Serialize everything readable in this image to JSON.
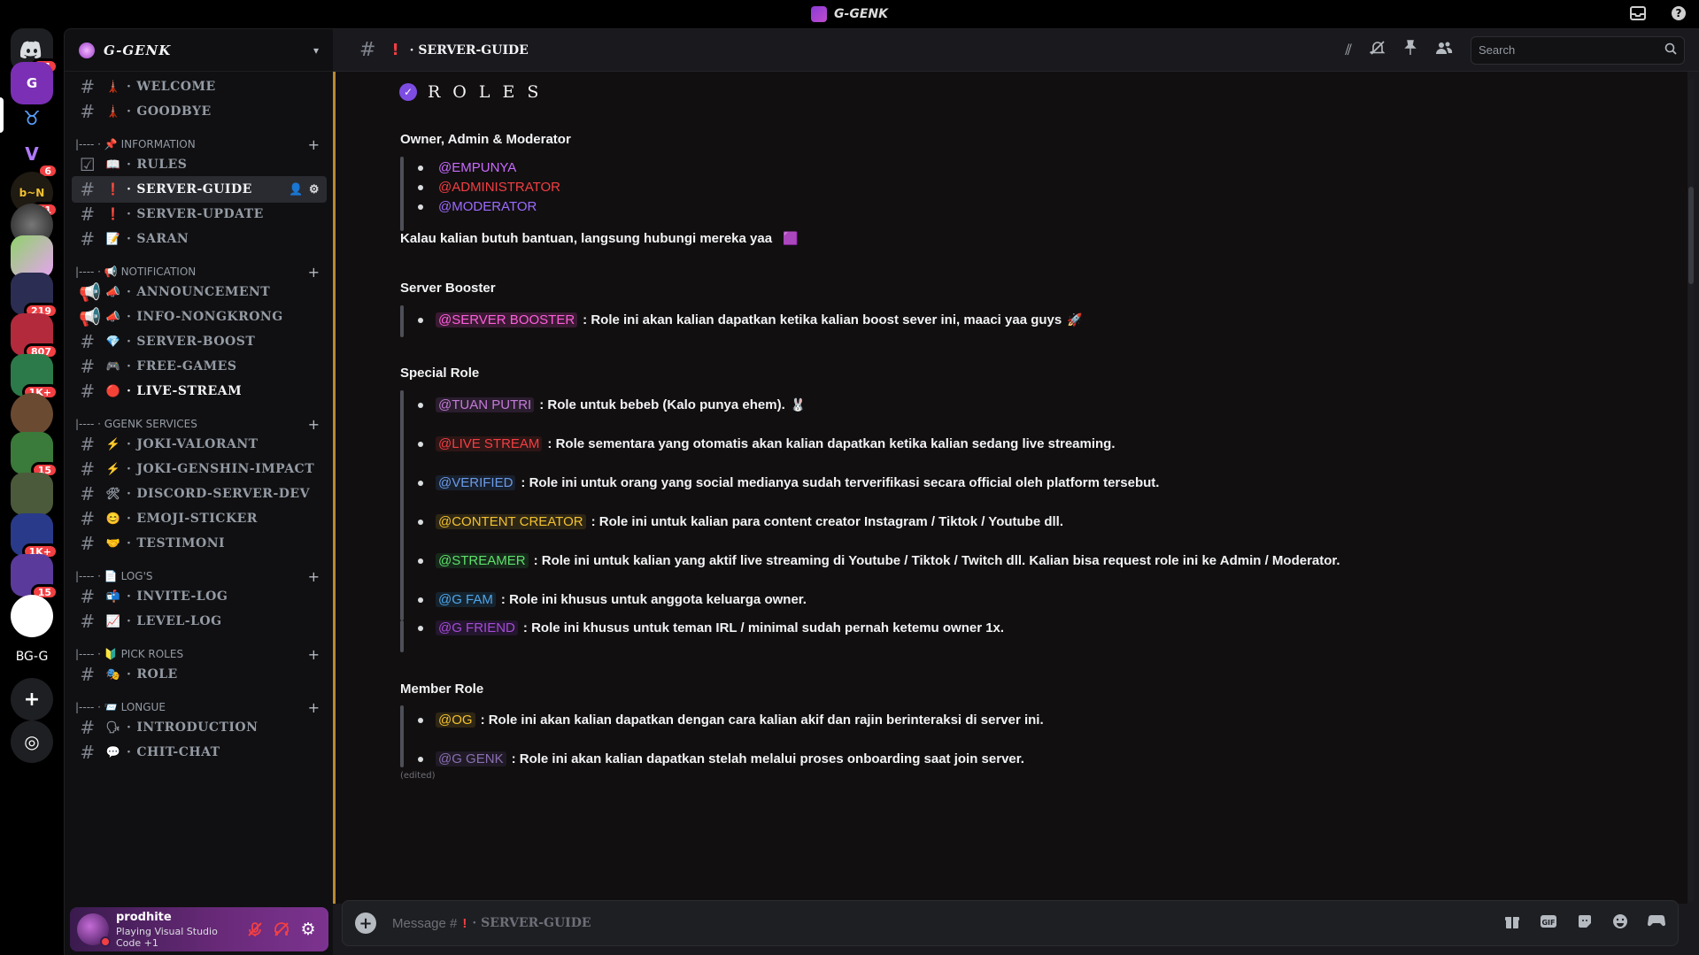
{
  "window": {
    "title": "G-GENK"
  },
  "rail": {
    "servers": [
      {
        "label": "",
        "badge": "11",
        "color": "#1e1f22",
        "icon": "discord-logo-icon"
      },
      {
        "label": "G",
        "badge": "",
        "color": "#7b2fb5",
        "icon": "g-genk-server-icon"
      },
      {
        "label": "♉",
        "badge": "",
        "color": "#000000",
        "icon": "zodiac-server-icon"
      },
      {
        "label": "V",
        "badge": "6",
        "color": "#000000",
        "icon": "v-server-icon"
      },
      {
        "label": "b~N",
        "badge": "51",
        "color": "#1f1a12",
        "icon": "bn-server-icon"
      },
      {
        "label": "",
        "badge": "",
        "color": "#3a3a3d",
        "icon": "photo-server-icon"
      },
      {
        "label": "",
        "badge": "",
        "color": "#8fd36a",
        "icon": "anime-server-icon"
      },
      {
        "label": "",
        "badge": "219",
        "color": "#4a4c7a",
        "icon": "folder-server-icon"
      },
      {
        "label": "",
        "badge": "807",
        "color": "#b32a3d",
        "icon": "folder-server-icon"
      },
      {
        "label": "",
        "badge": "1K+",
        "color": "#2c7a4a",
        "icon": "folder-server-icon"
      },
      {
        "label": "",
        "badge": "",
        "color": "#6b4a32",
        "icon": "folder-server-icon"
      },
      {
        "label": "",
        "badge": "15",
        "color": "#3a7a3a",
        "icon": "folder-server-icon"
      },
      {
        "label": "",
        "badge": "",
        "color": "#4a5a3a",
        "icon": "folder-server-icon"
      },
      {
        "label": "",
        "badge": "1K+",
        "color": "#2a3a8a",
        "icon": "folder-server-icon"
      },
      {
        "label": "",
        "badge": "15",
        "color": "#5a3a9a",
        "icon": "folder-server-icon"
      },
      {
        "label": "",
        "badge": "",
        "color": "#ffffff",
        "icon": "circle-logo-server-icon"
      },
      {
        "label": "BG-G",
        "badge": "",
        "color": "#000000",
        "icon": "text-server-icon"
      },
      {
        "label": "+",
        "badge": "",
        "color": "#1e1f22",
        "icon": "add-server-icon"
      },
      {
        "label": "◎",
        "badge": "",
        "color": "#1e1f22",
        "icon": "discover-icon"
      }
    ]
  },
  "sidebar": {
    "server_name": "G-GENK",
    "categories": [
      {
        "label": "|---- · 📌 INFORMATION",
        "key": "information"
      },
      {
        "label": "|---- · 📢 NOTIFICATION",
        "key": "notification"
      },
      {
        "label": "|---- · GGENK SERVICES",
        "key": "services"
      },
      {
        "label": "|---- · 📄 LOG'S",
        "key": "logs"
      },
      {
        "label": "|---- · 🔰 PICK ROLES",
        "key": "pickroles"
      },
      {
        "label": "|---- · 📨 LONGUE",
        "key": "longue"
      }
    ],
    "channels": [
      {
        "emoji": "🗼",
        "name": "WELCOME"
      },
      {
        "emoji": "🗼",
        "name": "GOODBYE"
      },
      {
        "emoji": "📖",
        "name": "RULES"
      },
      {
        "emoji": "❗",
        "name": "SERVER-GUIDE"
      },
      {
        "emoji": "❗",
        "name": "SERVER-UPDATE"
      },
      {
        "emoji": "📝",
        "name": "SARAN"
      },
      {
        "emoji": "📣",
        "name": "ANNOUNCEMENT"
      },
      {
        "emoji": "📣",
        "name": "INFO-NONGKRONG"
      },
      {
        "emoji": "💎",
        "name": "SERVER-BOOST"
      },
      {
        "emoji": "🎮",
        "name": "FREE-GAMES"
      },
      {
        "emoji": "🔴",
        "name": "LIVE-STREAM"
      },
      {
        "emoji": "⚡",
        "name": "JOKI-VALORANT"
      },
      {
        "emoji": "⚡",
        "name": "JOKI-GENSHIN-IMPACT"
      },
      {
        "emoji": "🛠",
        "name": "DISCORD-SERVER-DEV"
      },
      {
        "emoji": "😊",
        "name": "EMOJI-STICKER"
      },
      {
        "emoji": "🤝",
        "name": "TESTIMONI"
      },
      {
        "emoji": "📬",
        "name": "INVITE-LOG"
      },
      {
        "emoji": "📈",
        "name": "LEVEL-LOG"
      },
      {
        "emoji": "🎭",
        "name": "ROLE"
      },
      {
        "emoji": "🗣",
        "name": "INTRODUCTION"
      },
      {
        "emoji": "💬",
        "name": "CHIT-CHAT"
      }
    ],
    "user": {
      "name": "prodhite",
      "status": "Playing Visual Studio Code +1"
    }
  },
  "header": {
    "channel_name": "SERVER-GUIDE",
    "search_placeholder": "Search"
  },
  "content": {
    "title": "ROLES",
    "sec1_title": "Owner, Admin & Moderator",
    "sec1_mentions": [
      {
        "text": "@EMPUNYA",
        "color": "#c86bff"
      },
      {
        "text": "@ADMINISTRATOR",
        "color": "#f23f43"
      },
      {
        "text": "@MODERATOR",
        "color": "#9b6bff"
      }
    ],
    "sec1_note": "Kalau kalian butuh bantuan, langsung hubungi mereka yaa",
    "sec2_title": "Server Booster",
    "sec2_items": [
      {
        "mention": "@SERVER BOOSTER",
        "color": "#ff5edb",
        "desc": ": Role ini akan kalian dapatkan ketika kalian boost sever ini, maaci yaa guys"
      }
    ],
    "sec3_title": "Special Role",
    "sec3_items": [
      {
        "mention": "@TUAN PUTRI",
        "color": "#c47bd8",
        "desc": ": Role untuk bebeb (Kalo punya ehem)."
      },
      {
        "mention": "@LIVE STREAM",
        "color": "#f23f43",
        "desc": ": Role sementara yang otomatis akan kalian dapatkan ketika kalian sedang live streaming."
      },
      {
        "mention": "@VERIFIED",
        "color": "#6b9be8",
        "desc": ": Role ini untuk orang yang social medianya sudah terverifikasi secara official oleh platform tersebut."
      },
      {
        "mention": "@CONTENT CREATOR",
        "color": "#f2c12e",
        "desc": ": Role ini untuk kalian para content creator Instagram / Tiktok / Youtube dll."
      },
      {
        "mention": "@STREAMER",
        "color": "#5ee06b",
        "desc": ": Role ini untuk kalian yang aktif live streaming di Youtube / Tiktok / Twitch dll. Kalian bisa request role ini ke Admin / Moderator."
      },
      {
        "mention": "@G FAM",
        "color": "#4ea5e9",
        "desc": ": Role ini khusus untuk anggota keluarga owner."
      },
      {
        "mention": "@G FRIEND",
        "color": "#a64bd9",
        "desc": ": Role ini khusus untuk teman IRL / minimal sudah pernah ketemu owner 1x."
      }
    ],
    "sec4_title": "Member Role",
    "sec4_items": [
      {
        "mention": "@OG",
        "color": "#f2c12e",
        "desc": ": Role ini akan kalian dapatkan dengan cara kalian akif dan rajin berinteraksi di server ini."
      },
      {
        "mention": "@G GENK",
        "color": "#8a6fb0",
        "desc": ": Role ini akan kalian dapatkan stelah melalui proses onboarding saat join server."
      }
    ],
    "edited_label": "(edited)"
  },
  "composer": {
    "prefix": "Message #",
    "channel": "SERVER-GUIDE"
  }
}
